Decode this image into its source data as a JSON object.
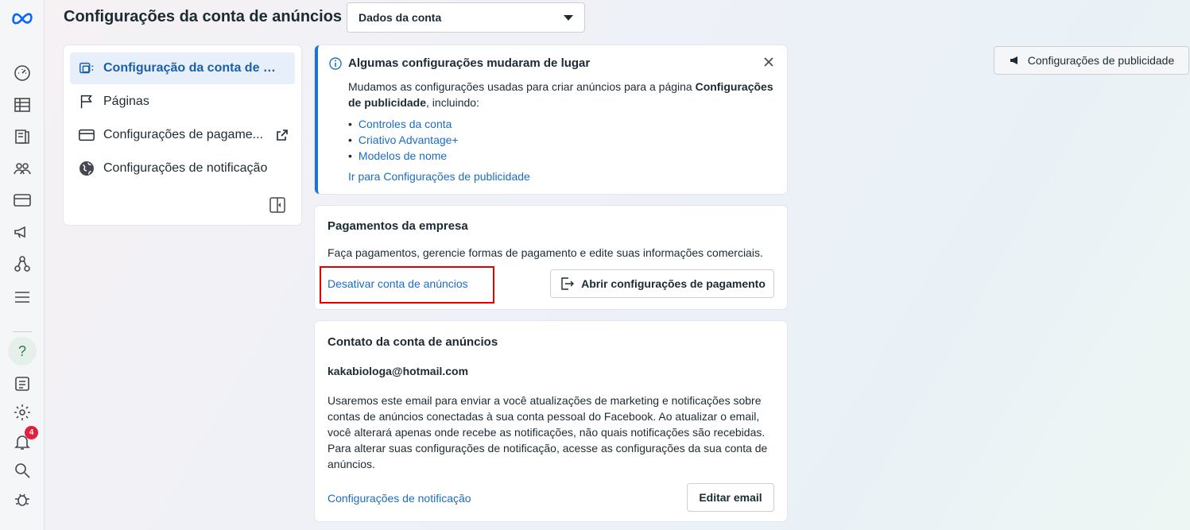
{
  "header": {
    "title": "Configurações da conta de anúncios",
    "account_select": "Dados da conta",
    "ad_settings_button": "Configurações de publicidade"
  },
  "rail": {
    "notification_count": "4",
    "help_label": "?"
  },
  "nav": {
    "items": [
      {
        "label": "Configuração da conta de a...",
        "active": true
      },
      {
        "label": "Páginas"
      },
      {
        "label": "Configurações de pagame..."
      },
      {
        "label": "Configurações de notificação"
      }
    ]
  },
  "notice": {
    "title": "Algumas configurações mudaram de lugar",
    "body_pre": "Mudamos as configurações usadas para criar anúncios para a página ",
    "body_bold": "Configurações de publicidade",
    "body_post": ", incluindo:",
    "links": [
      "Controles da conta",
      "Criativo Advantage+",
      "Modelos de nome"
    ],
    "go_link": "Ir para Configurações de publicidade"
  },
  "payments": {
    "title": "Pagamentos da empresa",
    "description": "Faça pagamentos, gerencie formas de pagamento e edite suas informações comerciais.",
    "deactivate_link": "Desativar conta de anúncios",
    "open_button": "Abrir configurações de pagamento"
  },
  "contact": {
    "title": "Contato da conta de anúncios",
    "email": "kakabiologa@hotmail.com",
    "paragraph": "Usaremos este email para enviar a você atualizações de marketing e notificações sobre contas de anúncios conectadas à sua conta pessoal do Facebook. Ao atualizar o email, você alterará apenas onde recebe as notificações, não quais notificações são recebidas. Para alterar suas configurações de notificação, acesse as configurações da sua conta de anúncios.",
    "notification_link": "Configurações de notificação",
    "edit_button": "Editar email"
  },
  "colors": {
    "accent": "#1877c9",
    "link": "#1b6dbf",
    "highlight": "#e00000",
    "badge": "#e41e3f"
  }
}
